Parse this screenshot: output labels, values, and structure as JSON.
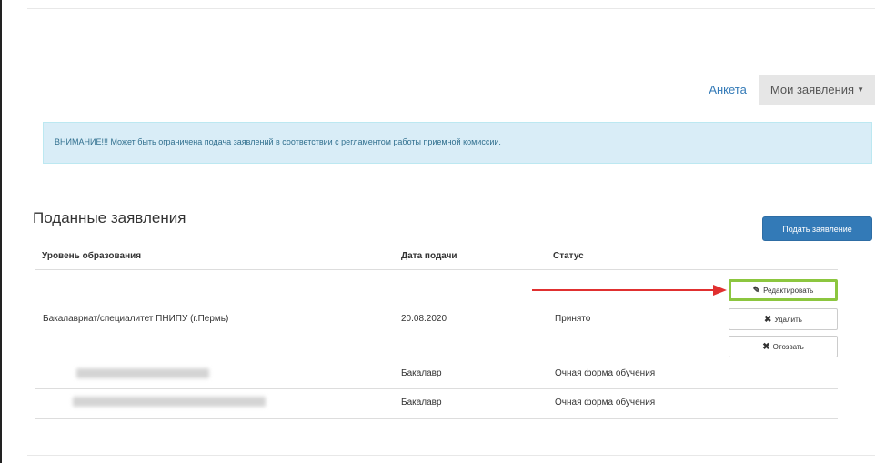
{
  "nav": {
    "profile_link": "Анкета",
    "applications_menu": "Мои заявления",
    "caret": "▼"
  },
  "alert": {
    "text": "ВНИМАНИЕ!!! Может быть ограничена подача заявлений в соответствии с регламентом работы приемной комиссии."
  },
  "submit_button": "Подать заявление",
  "section_title": "Поданные заявления",
  "table": {
    "columns": [
      "Уровень образования",
      "Дата подачи",
      "Статус"
    ],
    "row": {
      "level": "Бакалавриат/специалитет ПНИПУ (г.Пермь)",
      "date": "20.08.2020",
      "status": "Принято"
    },
    "subrows": [
      {
        "degree": "Бакалавр",
        "form": "Очная форма обучения"
      },
      {
        "degree": "Бакалавр",
        "form": "Очная форма обучения"
      }
    ],
    "actions": {
      "edit": "Редактировать",
      "delete": "Удалить",
      "withdraw": "Отозвать"
    }
  },
  "colors": {
    "primary": "#337ab7",
    "alert_bg": "#d9edf7",
    "highlight": "#8cc63f",
    "arrow": "#e03030"
  }
}
